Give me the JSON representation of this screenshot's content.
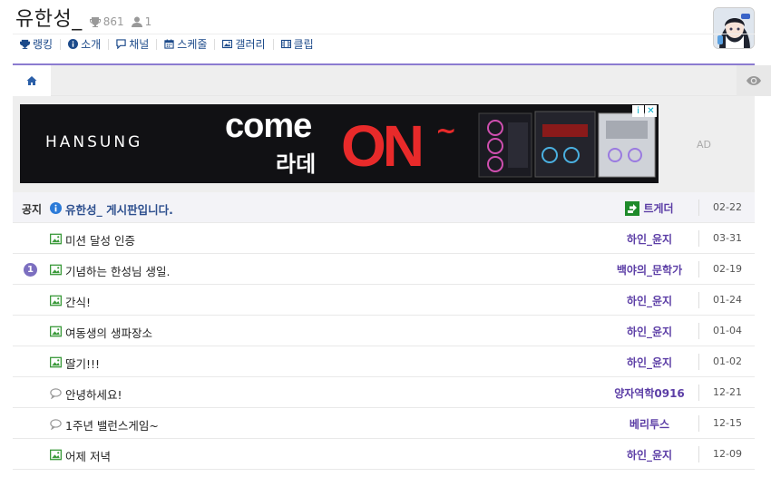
{
  "channel": {
    "title": "유한성_",
    "trophy_count": "861",
    "user_count": "1"
  },
  "menu": [
    {
      "label": "랭킹",
      "icon": "trophy-icon"
    },
    {
      "label": "소개",
      "icon": "info-icon"
    },
    {
      "label": "채널",
      "icon": "chat-icon"
    },
    {
      "label": "스케줄",
      "icon": "calendar-icon"
    },
    {
      "label": "갤러리",
      "icon": "image-icon"
    },
    {
      "label": "클립",
      "icon": "film-icon"
    }
  ],
  "ad": {
    "brand": "HANSUNG",
    "headline_a": "come",
    "headline_b": "라데",
    "headline_c": "ON",
    "headline_d": "~",
    "label": "AD",
    "info_mark": "i",
    "close_mark": "✕"
  },
  "posts": [
    {
      "badge": "공지",
      "type": "info",
      "title": "유한성_ 게시판입니다.",
      "author": "트게더",
      "author_icon": "true",
      "date": "02-22",
      "notice": "true"
    },
    {
      "badge": "",
      "type": "image",
      "title": "미션 달성 인증",
      "author": "하인_윤지",
      "date": "03-31"
    },
    {
      "badge": "1",
      "type": "image",
      "title": "기념하는 한성님 생일.",
      "author": "백야의_문학가",
      "date": "02-19"
    },
    {
      "badge": "",
      "type": "image",
      "title": "간식!",
      "author": "하인_윤지",
      "date": "01-24"
    },
    {
      "badge": "",
      "type": "image",
      "title": "여동생의 생파장소",
      "author": "하인_윤지",
      "date": "01-04"
    },
    {
      "badge": "",
      "type": "image",
      "title": "딸기!!!",
      "author": "하인_윤지",
      "date": "01-02"
    },
    {
      "badge": "",
      "type": "chat",
      "title": "안녕하세요!",
      "author": "양자역학0916",
      "date": "12-21"
    },
    {
      "badge": "",
      "type": "chat",
      "title": "1주년 밸런스게임~",
      "author": "베리투스",
      "date": "12-15"
    },
    {
      "badge": "",
      "type": "image",
      "title": "어제 저녁",
      "author": "하인_윤지",
      "date": "12-09"
    }
  ],
  "colors": {
    "accent_purple": "#8b7bd0",
    "author_purple": "#5c3ea6",
    "link_blue": "#1c4a8a",
    "image_green": "#3a9a3a",
    "ad_red": "#e82a2a"
  }
}
